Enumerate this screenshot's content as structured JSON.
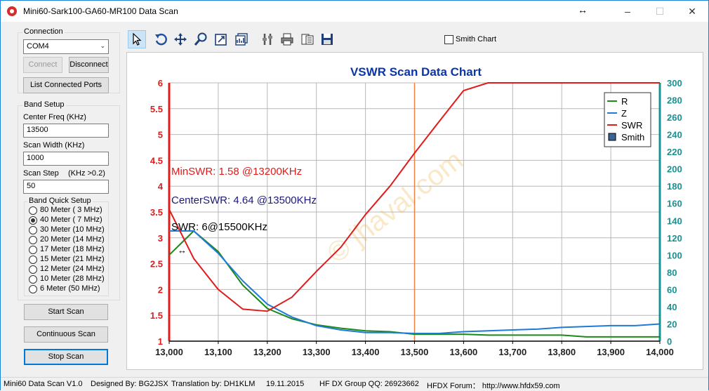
{
  "window": {
    "title": "Mini60-Sark100-GA60-MR100 Data Scan",
    "colors": {
      "border": "#1883d7",
      "title_icon": "#d62c2c"
    }
  },
  "connection": {
    "label": "Connection",
    "port_value": "COM4",
    "connect_label": "Connect",
    "disconnect_label": "Disconnect",
    "list_ports_label": "List Connected Ports"
  },
  "band_setup": {
    "label": "Band Setup",
    "center_freq_label": "Center Freq  (KHz)",
    "center_freq_value": "13500",
    "scan_width_label": "Scan Width   (KHz)",
    "scan_width_value": "1000",
    "scan_step_label": "Scan Step",
    "scan_step_hint": "(KHz >0.2)",
    "scan_step_value": "50",
    "quick_setup_label": "Band Quick Setup",
    "bands": [
      {
        "label": "80 Meter  ( 3 MHz)",
        "checked": false
      },
      {
        "label": "40 Meter  ( 7 MHz)",
        "checked": true
      },
      {
        "label": "30 Meter (10 MHz)",
        "checked": false
      },
      {
        "label": "20 Meter (14 MHz)",
        "checked": false
      },
      {
        "label": "17 Meter (18 MHz)",
        "checked": false
      },
      {
        "label": "15 Meter (21 MHz)",
        "checked": false
      },
      {
        "label": "12 Meter (24 MHz)",
        "checked": false
      },
      {
        "label": "10 Meter (28 MHz)",
        "checked": false
      },
      {
        "label": " 6 Meter  (50 MHz)",
        "checked": false
      }
    ]
  },
  "scan_buttons": {
    "start_label": "Start Scan",
    "continuous_label": "Continuous Scan",
    "stop_label": "Stop Scan"
  },
  "toolbar": {
    "icons": [
      "pointer-icon",
      "undo-icon",
      "pan-icon",
      "zoom-icon",
      "zoom-rect-icon",
      "chart-props-icon",
      "tools-icon",
      "print-icon",
      "export-icon",
      "save-icon"
    ],
    "smith_chart_label": "Smith Chart",
    "smith_chart_checked": false
  },
  "chart_data": {
    "type": "line",
    "title": "VSWR Scan Data Chart",
    "x_ticks": [
      "13,000",
      "13,100",
      "13,200",
      "13,300",
      "13,400",
      "13,500",
      "13,600",
      "13,700",
      "13,800",
      "13,900",
      "14,000"
    ],
    "xlim": [
      13000,
      14000
    ],
    "y_left_ticks": [
      "1",
      "1.5",
      "2",
      "2.5",
      "3",
      "3.5",
      "4",
      "4.5",
      "5",
      "5.5",
      "6"
    ],
    "ylim_left": [
      1,
      6
    ],
    "y_right_ticks": [
      "0",
      "20",
      "40",
      "60",
      "80",
      "100",
      "120",
      "140",
      "160",
      "180",
      "200",
      "220",
      "240",
      "260",
      "280",
      "300"
    ],
    "ylim_right": [
      0,
      300
    ],
    "grid": true,
    "legend_position": "top-right",
    "center_marker_x": 13500,
    "x": [
      13000,
      13050,
      13100,
      13150,
      13200,
      13250,
      13300,
      13350,
      13400,
      13450,
      13500,
      13550,
      13600,
      13650,
      13700,
      13750,
      13800,
      13850,
      13900,
      13950,
      14000
    ],
    "series": [
      {
        "name": "R",
        "axis": "right",
        "color": "#1a8a1a",
        "values": [
          100,
          128,
          104,
          65,
          38,
          26,
          19,
          15,
          12,
          11,
          8,
          8,
          8,
          7,
          7,
          7,
          7,
          5,
          5,
          5,
          5
        ]
      },
      {
        "name": "Z",
        "axis": "right",
        "color": "#1f7ad8",
        "values": [
          128,
          128,
          102,
          70,
          43,
          28,
          18,
          13,
          10,
          10,
          9,
          9,
          11,
          12,
          13,
          14,
          16,
          17,
          18,
          18,
          20
        ]
      },
      {
        "name": "SWR",
        "axis": "left",
        "color": "#e11a1a",
        "values": [
          3.55,
          2.6,
          2.0,
          1.62,
          1.58,
          1.85,
          2.35,
          2.82,
          3.45,
          4.0,
          4.64,
          5.25,
          5.85,
          6.0,
          6.0,
          6.0,
          6.0,
          6.0,
          6.0,
          6.0,
          6.0
        ]
      }
    ],
    "legend": [
      {
        "name": "R",
        "color": "#1a8a1a",
        "kind": "line"
      },
      {
        "name": "Z",
        "color": "#1f7ad8",
        "kind": "line"
      },
      {
        "name": "SWR",
        "color": "#e11a1a",
        "kind": "line"
      },
      {
        "name": "Smith",
        "color": "#3c6296",
        "kind": "box"
      }
    ],
    "annotations": [
      {
        "text": "MinSWR: 1.58 @13200KHz",
        "color": "#e11a1a"
      },
      {
        "text": "CenterSWR: 4.64 @13500KHz",
        "color": "#1a1a7a"
      },
      {
        "text": "SWR: 6@15500KHz",
        "color": "#000000"
      }
    ],
    "watermark": "© jhaval.com",
    "colors": {
      "title": "#0b36a8",
      "left_axis": "#e11a1a",
      "right_axis": "#1a9090",
      "center_marker": "#f08040",
      "grid": "#b8b8b8"
    }
  },
  "status_bar": {
    "version": "Mini60 Data Scan V1.0",
    "designed_by": "Designed By: BG2JSX",
    "translation": "Translation by: DH1KLM",
    "date": "19.11.2015",
    "group": "HF DX Group QQ: 26923662",
    "forum": "HFDX Forum：  http://www.hfdx59.com"
  }
}
